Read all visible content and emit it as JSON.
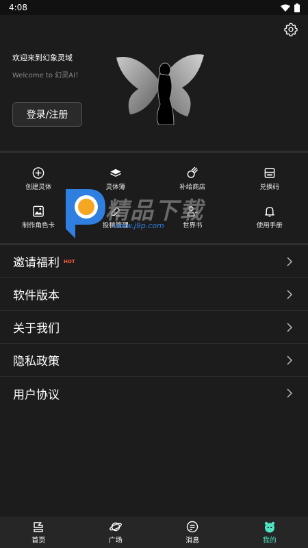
{
  "status_bar": {
    "time": "4:08"
  },
  "header": {
    "welcome_title": "欢迎来到幻象灵域",
    "welcome_subtitle": "Welcome to 幻灵AI！",
    "login_label": "登录/注册"
  },
  "grid": {
    "items": [
      {
        "label": "创建灵体",
        "icon": "plus-circle-icon"
      },
      {
        "label": "灵体簿",
        "icon": "book-icon"
      },
      {
        "label": "补给商店",
        "icon": "meteor-icon"
      },
      {
        "label": "兑换码",
        "icon": "card-icon"
      },
      {
        "label": "制作角色卡",
        "icon": "image-icon"
      },
      {
        "label": "投稿管理",
        "icon": "edit-icon"
      },
      {
        "label": "世界书",
        "icon": "user-book-icon"
      },
      {
        "label": "使用手册",
        "icon": "bell-icon"
      }
    ]
  },
  "menu": {
    "items": [
      {
        "label": "邀请福利",
        "badge": "HOT"
      },
      {
        "label": "软件版本"
      },
      {
        "label": "关于我们"
      },
      {
        "label": "隐私政策"
      },
      {
        "label": "用户协议"
      }
    ]
  },
  "watermark": {
    "text": "精品下载",
    "url": "www.j9p.com"
  },
  "tabbar": {
    "items": [
      {
        "label": "首页",
        "icon": "home-icon"
      },
      {
        "label": "广场",
        "icon": "planet-icon"
      },
      {
        "label": "消息",
        "icon": "message-icon"
      },
      {
        "label": "我的",
        "icon": "profile-icon",
        "active": true
      }
    ]
  },
  "colors": {
    "background": "#1c1c1c",
    "accent": "#4fe3c1",
    "hot": "#ff5a3c"
  }
}
